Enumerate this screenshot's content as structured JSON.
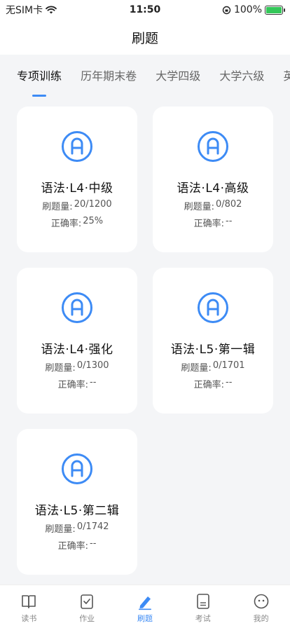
{
  "status": {
    "carrier": "无SIM卡",
    "time": "11:50",
    "battery_percent": "100%"
  },
  "nav": {
    "title": "刷题"
  },
  "tabs": [
    {
      "label": "专项训练",
      "active": true
    },
    {
      "label": "历年期末卷",
      "active": false
    },
    {
      "label": "大学四级",
      "active": false
    },
    {
      "label": "大学六级",
      "active": false
    },
    {
      "label": "英语专",
      "active": false
    }
  ],
  "cards": [
    {
      "title": "语法·L4·中级",
      "count_label": "刷题量:",
      "count": "20/1200",
      "accuracy_label": "正确率:",
      "accuracy": "25%"
    },
    {
      "title": "语法·L4·高级",
      "count_label": "刷题量:",
      "count": "0/802",
      "accuracy_label": "正确率:",
      "accuracy": "--"
    },
    {
      "title": "语法·L4·强化",
      "count_label": "刷题量:",
      "count": "0/1300",
      "accuracy_label": "正确率:",
      "accuracy": "--"
    },
    {
      "title": "语法·L5·第一辑",
      "count_label": "刷题量:",
      "count": "0/1701",
      "accuracy_label": "正确率:",
      "accuracy": "--"
    },
    {
      "title": "语法·L5·第二辑",
      "count_label": "刷题量:",
      "count": "0/1742",
      "accuracy_label": "正确率:",
      "accuracy": "--"
    }
  ],
  "tabbar": [
    {
      "label": "读书",
      "icon": "book-icon",
      "active": false
    },
    {
      "label": "作业",
      "icon": "homework-icon",
      "active": false
    },
    {
      "label": "刷题",
      "icon": "pen-icon",
      "active": true
    },
    {
      "label": "考试",
      "icon": "exam-icon",
      "active": false
    },
    {
      "label": "我的",
      "icon": "profile-icon",
      "active": false
    }
  ],
  "colors": {
    "accent": "#3d8bf5",
    "background": "#f4f5f7"
  }
}
